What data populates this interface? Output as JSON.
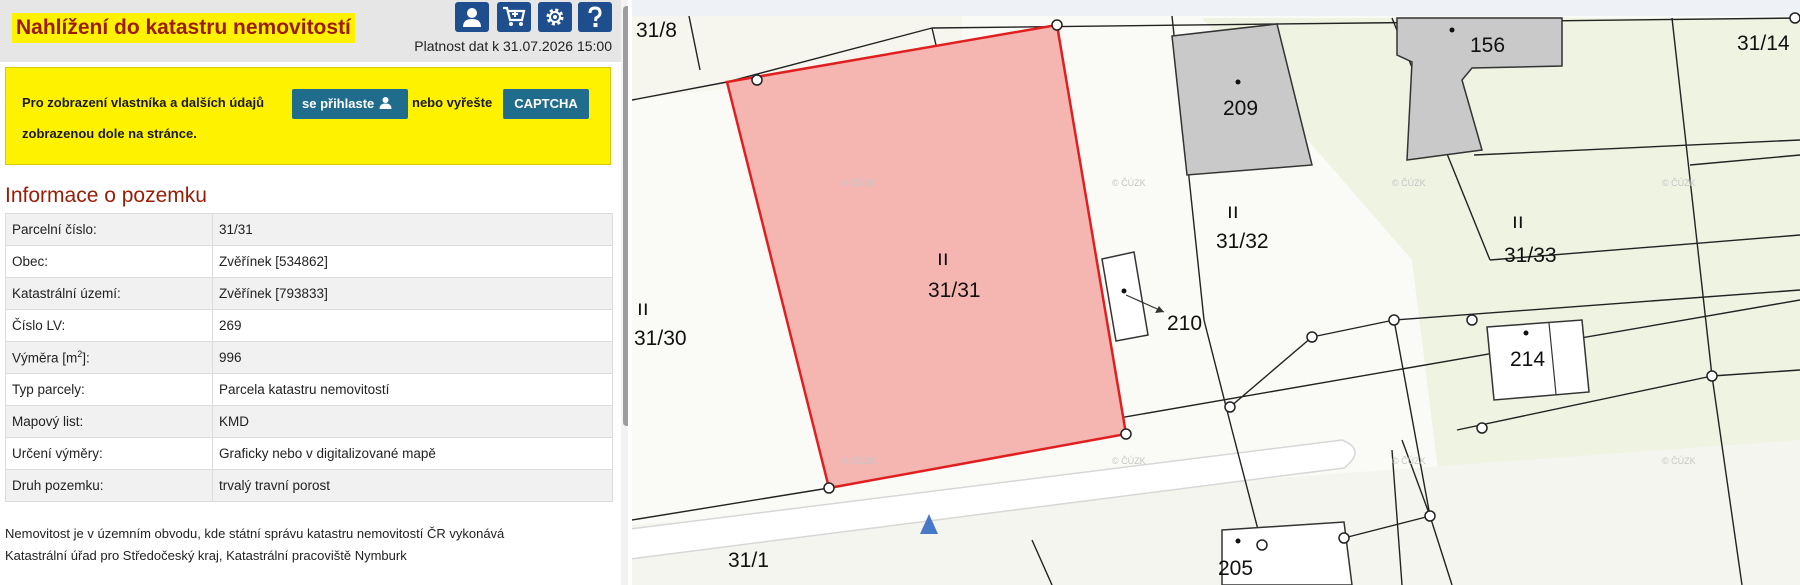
{
  "header": {
    "title": "Nahlížení do katastru nemovitostí",
    "platnost": "Platnost dat k 31.07.2026 15:00",
    "icons": [
      "user-icon",
      "cart-icon",
      "gear-icon",
      "help-icon"
    ],
    "accent_color": "#1f4e8f"
  },
  "notice": {
    "text_before": "Pro zobrazení vlastníka a dalších údajů",
    "login_label": "se přihlaste",
    "text_middle": "nebo vyřešte",
    "captcha_label": "CAPTCHA",
    "text_after": "zobrazenou dole na stránce."
  },
  "info": {
    "title": "Informace o pozemku",
    "rows": [
      {
        "label": "Parcelní číslo:",
        "value": "31/31"
      },
      {
        "label": "Obec:",
        "value": "Zvěřínek [534862]"
      },
      {
        "label": "Katastrální území:",
        "value": "Zvěřínek [793833]"
      },
      {
        "label": "Číslo LV:",
        "value": "269"
      },
      {
        "label": "Výměra [m2]:",
        "value": "996"
      },
      {
        "label": "Typ parcely:",
        "value": "Parcela katastru nemovitostí"
      },
      {
        "label": "Mapový list:",
        "value": "KMD"
      },
      {
        "label": "Určení výměry:",
        "value": "Graficky nebo v digitalizované mapě"
      },
      {
        "label": "Druh pozemku:",
        "value": "trvalý travní porost"
      }
    ]
  },
  "footnote": {
    "line1": "Nemovitost je v územním obvodu, kde státní správu katastru nemovitostí ČR vykonává",
    "line2": "Katastrální úřad pro Středočeský kraj, Katastrální pracoviště Nymburk"
  },
  "map": {
    "parcel_labels": [
      "31/8",
      "31/14",
      "31/30",
      "31/31",
      "31/32",
      "31/33",
      "31/1"
    ],
    "building_labels": [
      "156",
      "209",
      "210",
      "214",
      "205"
    ],
    "grass_symbol": "ıı",
    "watermark": "© ČÚZK",
    "selected_color": "#f5b6b2",
    "selected_border": "#e02020"
  }
}
